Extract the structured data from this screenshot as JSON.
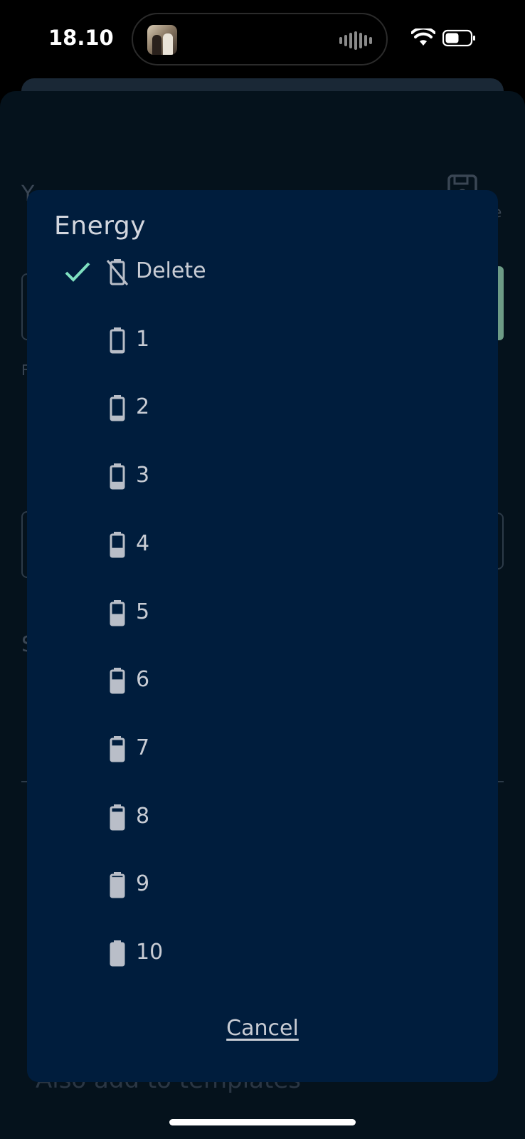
{
  "status_bar": {
    "time": "18.10",
    "now_playing_icon": "album-art-thumbnail",
    "waveform_icon": "audio-waveform-icon",
    "wifi_icon": "wifi-icon",
    "battery_icon": "battery-icon"
  },
  "background": {
    "save_icon": "floppy-disk-icon",
    "left_letter_top": "Y",
    "left_letter_f": "F",
    "left_letter_s": "S",
    "right_letter": "e",
    "bottom_text": "Also add to templates"
  },
  "dialog": {
    "title": "Energy",
    "options": [
      {
        "label": "Delete",
        "selected": true,
        "icon": "battery-off-icon",
        "fill_level": 0
      },
      {
        "label": "1",
        "selected": false,
        "icon": "battery-icon",
        "fill_level": 0.1
      },
      {
        "label": "2",
        "selected": false,
        "icon": "battery-icon",
        "fill_level": 0.2
      },
      {
        "label": "3",
        "selected": false,
        "icon": "battery-icon",
        "fill_level": 0.3
      },
      {
        "label": "4",
        "selected": false,
        "icon": "battery-icon",
        "fill_level": 0.4
      },
      {
        "label": "5",
        "selected": false,
        "icon": "battery-icon",
        "fill_level": 0.5
      },
      {
        "label": "6",
        "selected": false,
        "icon": "battery-icon",
        "fill_level": 0.6
      },
      {
        "label": "7",
        "selected": false,
        "icon": "battery-icon",
        "fill_level": 0.7
      },
      {
        "label": "8",
        "selected": false,
        "icon": "battery-icon",
        "fill_level": 0.8
      },
      {
        "label": "9",
        "selected": false,
        "icon": "battery-icon",
        "fill_level": 0.9
      },
      {
        "label": "10",
        "selected": false,
        "icon": "battery-icon",
        "fill_level": 1.0
      }
    ],
    "cancel_label": "Cancel"
  },
  "colors": {
    "dialog_bg": "#001d3d",
    "check_color": "#7fe0c0",
    "icon_color": "#b9bec8",
    "text_color": "#c8ccd4"
  }
}
